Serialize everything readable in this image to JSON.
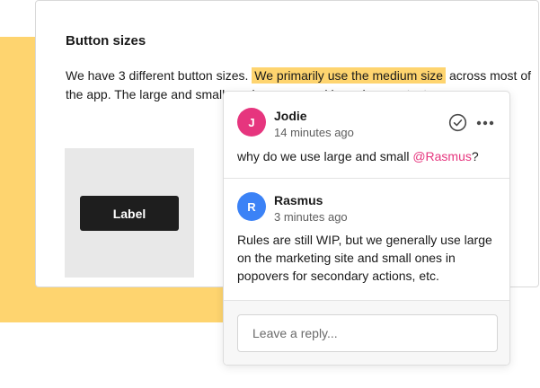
{
  "colors": {
    "accent_yellow": "#fed46f",
    "avatar_jodie": "#e6357e",
    "avatar_rasmus": "#3b82f6",
    "mention": "#e6357e",
    "button_dark": "#1e1e1e"
  },
  "doc": {
    "title": "Button sizes",
    "body_before": "We have 3 different button sizes. ",
    "body_highlight": "We primarily use the medium size",
    "body_after": " across most of the app. The large and small versions are used based on context.",
    "preview_button_label": "Label"
  },
  "comments": [
    {
      "avatar_initial": "J",
      "author": "Jodie",
      "timestamp": "14 minutes ago",
      "text_before": "why do we use large and small ",
      "mention": "@Rasmus",
      "text_after": "?",
      "resolve_icon": "check-circle-icon",
      "more_icon": "more-horizontal-icon"
    },
    {
      "avatar_initial": "R",
      "author": "Rasmus",
      "timestamp": "3 minutes ago",
      "text": "Rules are still WIP, but we generally use large on the marketing site and small ones in popovers for secondary actions, etc."
    }
  ],
  "reply": {
    "placeholder": "Leave a reply..."
  }
}
